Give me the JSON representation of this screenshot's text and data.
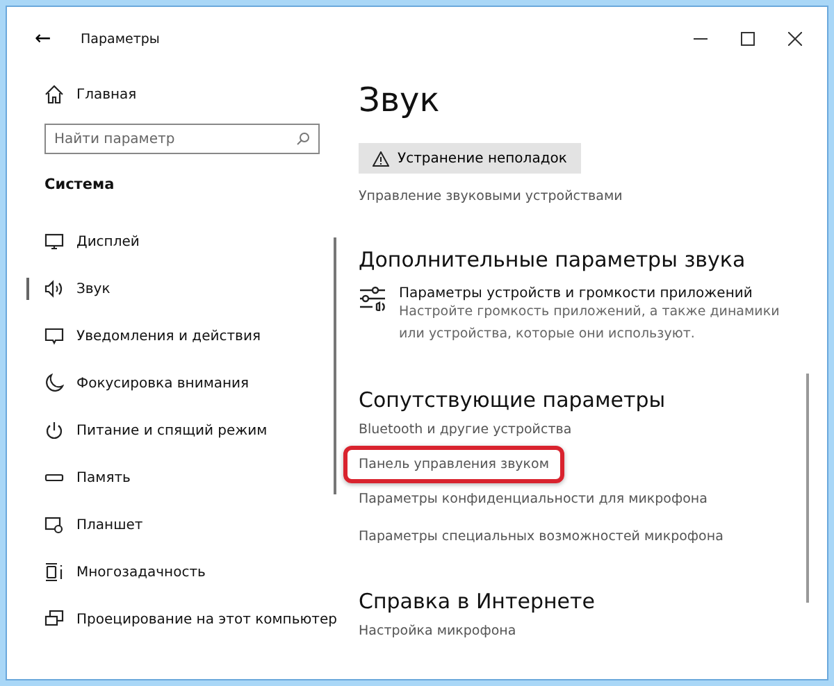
{
  "window": {
    "title": "Параметры",
    "back": "←"
  },
  "sidebar": {
    "home": "Главная",
    "search": {
      "placeholder": "Найти параметр"
    },
    "section": "Система",
    "items": [
      {
        "label": "Дисплей",
        "kind": "display",
        "selected": false
      },
      {
        "label": "Звук",
        "kind": "sound",
        "selected": true
      },
      {
        "label": "Уведомления и действия",
        "kind": "notify",
        "selected": false
      },
      {
        "label": "Фокусировка внимания",
        "kind": "moon",
        "selected": false
      },
      {
        "label": "Питание и спящий режим",
        "kind": "power",
        "selected": false
      },
      {
        "label": "Память",
        "kind": "storage",
        "selected": false
      },
      {
        "label": "Планшет",
        "kind": "tablet",
        "selected": false
      },
      {
        "label": "Многозадачность",
        "kind": "multitask",
        "selected": false
      },
      {
        "label": "Проецирование на этот компьютер",
        "kind": "project",
        "selected": false
      }
    ]
  },
  "content": {
    "title": "Звук",
    "troubleshoot": "Устранение неполадок",
    "manage_link": "Управление звуковыми устройствами",
    "sections": [
      {
        "heading": "Дополнительные параметры звука",
        "kind": "setting",
        "title": "Параметры устройств и громкости приложений",
        "description": "Настройте громкость приложений, а также динамики или устройства, которые они используют."
      },
      {
        "heading": "Сопутствующие параметры",
        "kind": "links",
        "links": [
          {
            "label": "Bluetooth и другие устройства",
            "highlighted": false
          },
          {
            "label": "Панель управления звуком",
            "highlighted": true
          },
          {
            "label": "Параметры конфиденциальности для микрофона",
            "highlighted": false
          },
          {
            "label": "Параметры специальных возможностей микрофона",
            "highlighted": false
          }
        ]
      },
      {
        "heading": "Справка в Интернете",
        "kind": "links",
        "links": [
          {
            "label": "Настройка микрофона",
            "highlighted": false
          }
        ]
      }
    ]
  }
}
